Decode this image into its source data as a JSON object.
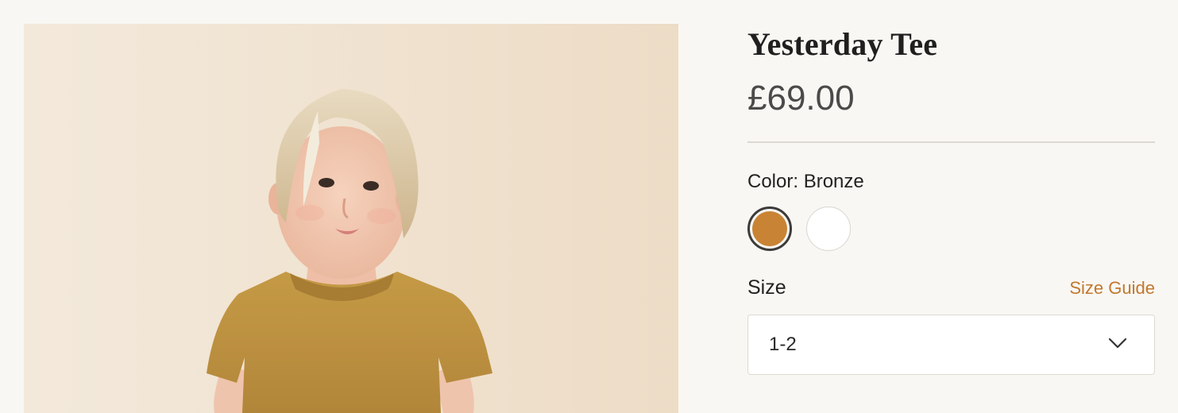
{
  "product": {
    "title": "Yesterday Tee",
    "price": "£69.00",
    "image_alt": "Child wearing bronze tee"
  },
  "color_option": {
    "label": "Color:",
    "selected": "Bronze",
    "swatches": [
      {
        "name": "Bronze",
        "color": "#c98334",
        "selected": true
      },
      {
        "name": "White",
        "color": "#ffffff",
        "selected": false
      }
    ]
  },
  "size_option": {
    "label": "Size",
    "guide_link": "Size Guide",
    "selected_value": "1-2"
  },
  "icons": {
    "dropdown": "chevron-down-icon"
  },
  "colors": {
    "accent": "#c1782e",
    "background": "#f9f7f3"
  }
}
